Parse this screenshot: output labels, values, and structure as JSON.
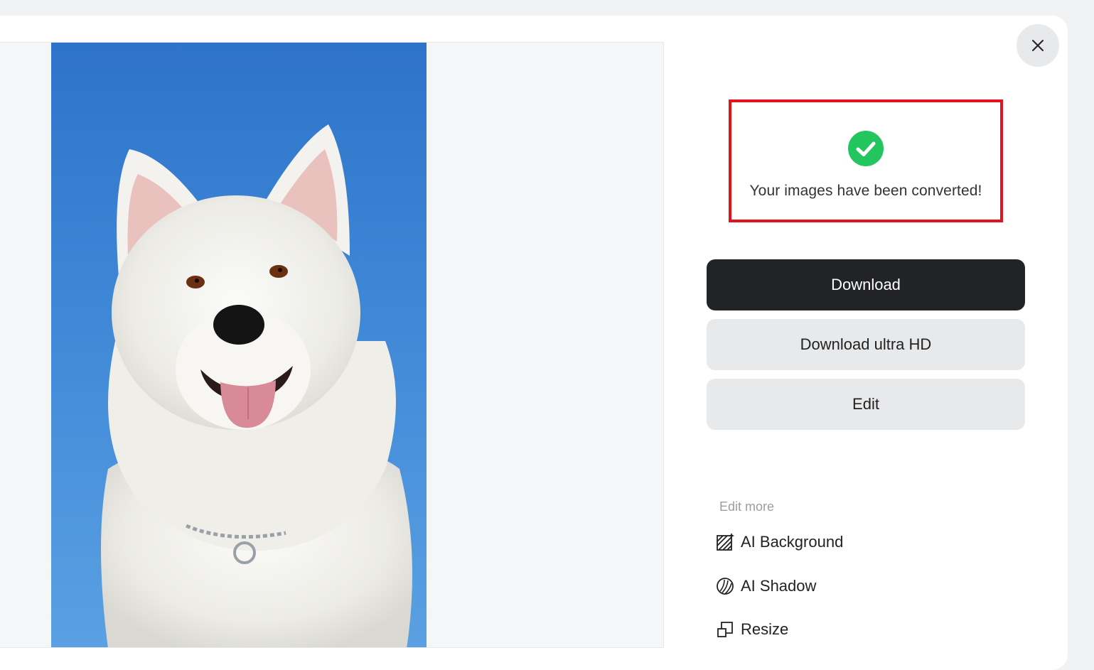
{
  "status": {
    "message": "Your images have been converted!",
    "icon": "check-circle-icon",
    "icon_color": "#22c55e",
    "highlight_color": "#e0141c"
  },
  "actions": {
    "download": "Download",
    "download_hd": "Download ultra HD",
    "edit": "Edit"
  },
  "edit_more": {
    "label": "Edit more",
    "items": [
      {
        "label": "AI Background",
        "icon": "ai-background-icon"
      },
      {
        "label": "AI Shadow",
        "icon": "ai-shadow-icon"
      },
      {
        "label": "Resize",
        "icon": "resize-icon"
      }
    ]
  },
  "preview": {
    "subject": "white-dog-photo"
  },
  "colors": {
    "primary_button": "#222326",
    "secondary_button": "#e8e9eb"
  }
}
